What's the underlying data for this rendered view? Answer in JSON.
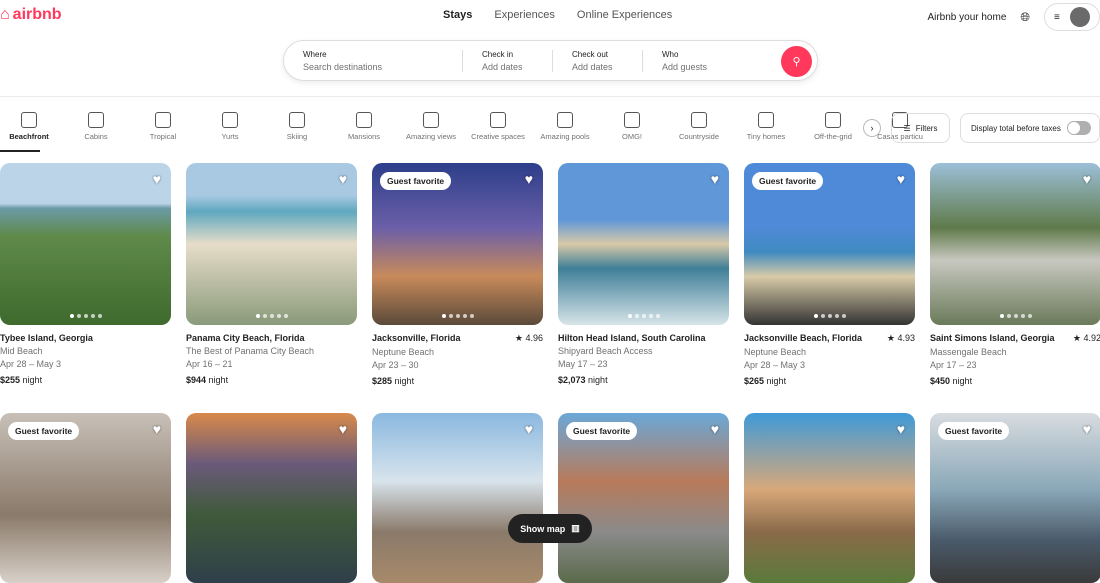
{
  "header": {
    "logo": "airbnb",
    "nav": [
      "Stays",
      "Experiences",
      "Online Experiences"
    ],
    "host_link": "Airbnb your home"
  },
  "search": {
    "fields": [
      {
        "label": "Where",
        "placeholder": "Search destinations"
      },
      {
        "label": "Check in",
        "placeholder": "Add dates"
      },
      {
        "label": "Check out",
        "placeholder": "Add dates"
      },
      {
        "label": "Who",
        "placeholder": "Add guests"
      }
    ]
  },
  "categories": [
    "Beachfront",
    "Cabins",
    "Tropical",
    "Yurts",
    "Skiing",
    "Mansions",
    "Amazing views",
    "Creative spaces",
    "Amazing pools",
    "OMG!",
    "Countryside",
    "Tiny homes",
    "Off-the-grid",
    "Casas particu"
  ],
  "filters_label": "Filters",
  "taxes_label": "Display total before taxes",
  "taxes_toggle_on": false,
  "accent": "#ff385c",
  "listings": [
    {
      "title": "Tybee Island, Georgia",
      "subtitle": "Mid Beach",
      "dates": "Apr 28 – May 3",
      "price": "$255",
      "unit": "night",
      "rating": "",
      "badge": ""
    },
    {
      "title": "Panama City Beach, Florida",
      "subtitle": "The Best of Panama City Beach",
      "dates": "Apr 16 – 21",
      "price": "$944",
      "unit": "night",
      "rating": "",
      "badge": ""
    },
    {
      "title": "Jacksonville, Florida",
      "subtitle": "Neptune Beach",
      "dates": "Apr 23 – 30",
      "price": "$285",
      "unit": "night",
      "rating": "★ 4.96",
      "badge": "Guest favorite"
    },
    {
      "title": "Hilton Head Island, South Carolina",
      "subtitle": "Shipyard Beach Access",
      "dates": "May 17 – 23",
      "price": "$2,073",
      "unit": "night",
      "rating": "",
      "badge": ""
    },
    {
      "title": "Jacksonville Beach, Florida",
      "subtitle": "Neptune Beach",
      "dates": "Apr 28 – May 3",
      "price": "$265",
      "unit": "night",
      "rating": "★ 4.93",
      "badge": "Guest favorite"
    },
    {
      "title": "Saint Simons Island, Georgia",
      "subtitle": "Massengale Beach",
      "dates": "Apr 17 – 23",
      "price": "$450",
      "unit": "night",
      "rating": "★ 4.92",
      "badge": ""
    }
  ],
  "row2_badges": [
    "Guest favorite",
    "",
    "",
    "Guest favorite",
    "",
    "Guest favorite"
  ],
  "show_map": "Show map"
}
